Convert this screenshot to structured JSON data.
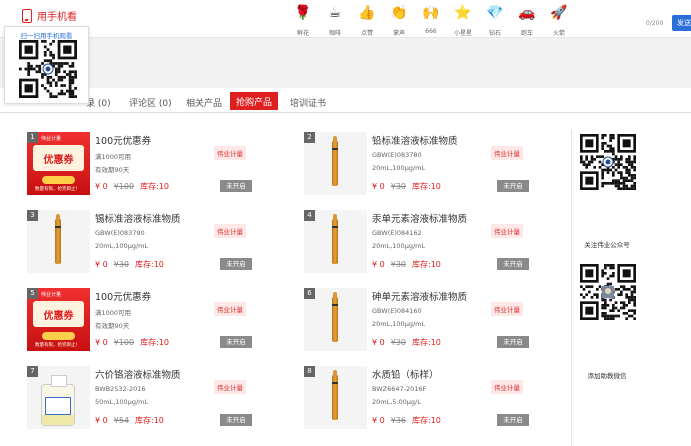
{
  "header": {
    "phone_view_label": "用手机看",
    "qr_popup_title": "扫一扫用手机观看",
    "gifts": [
      {
        "icon": "rose-icon",
        "glyph": "🌹",
        "label": "鲜花"
      },
      {
        "icon": "coffee-icon",
        "glyph": "☕",
        "label": "咖啡"
      },
      {
        "icon": "like-icon",
        "glyph": "👍",
        "label": "点赞"
      },
      {
        "icon": "applause-icon",
        "glyph": "👏",
        "label": "掌声"
      },
      {
        "icon": "666-icon",
        "glyph": "🙌",
        "label": "666"
      },
      {
        "icon": "little-star-icon",
        "glyph": "⭐",
        "label": "小星星"
      },
      {
        "icon": "diamond-icon",
        "glyph": "💎",
        "label": "钻石"
      },
      {
        "icon": "sports-car-icon",
        "glyph": "🚗",
        "label": "跑车"
      },
      {
        "icon": "rocket-icon",
        "glyph": "🚀",
        "label": "火箭"
      }
    ],
    "char_count": "0/200",
    "send_label": "发送"
  },
  "tabs": [
    {
      "label": "录 (0)"
    },
    {
      "label": "评论区 (0)"
    },
    {
      "label": "相关产品"
    },
    {
      "label": "抢购产品",
      "active": true
    },
    {
      "label": "培训证书"
    }
  ],
  "products": [
    {
      "num": "1",
      "kind": "coupon",
      "title": "100元优惠券",
      "line1": "满1000可用",
      "line2": "有效期90天",
      "tag": "伟业计量",
      "price": "¥ 0",
      "old_price": "¥100",
      "stock": "库存:10",
      "status": "未开启",
      "coupon": {
        "top": "伟业计量",
        "text": "优惠券",
        "foot": "数量有限，抢完即止！"
      }
    },
    {
      "num": "2",
      "kind": "vial",
      "title": "铅标准溶液标准物质",
      "line1": "GBW(E)083780",
      "line2": "20mL,100μg/mL",
      "tag": "伟业计量",
      "price": "¥ 0",
      "old_price": "¥30",
      "stock": "库存:10",
      "status": "未开启"
    },
    {
      "num": "3",
      "kind": "vial",
      "title": "锡标准溶液标准物质",
      "line1": "GBW(E)083790",
      "line2": "20mL,100μg/mL",
      "tag": "伟业计量",
      "price": "¥ 0",
      "old_price": "¥30",
      "stock": "库存:10",
      "status": "未开启"
    },
    {
      "num": "4",
      "kind": "vial",
      "title": "汞单元素溶液标准物质",
      "line1": "GBW(E)084162",
      "line2": "20mL,100μg/mL",
      "tag": "伟业计量",
      "price": "¥ 0",
      "old_price": "¥30",
      "stock": "库存:10",
      "status": "未开启"
    },
    {
      "num": "5",
      "kind": "coupon",
      "title": "100元优惠券",
      "line1": "满1000可用",
      "line2": "有效期90天",
      "tag": "伟业计量",
      "price": "¥ 0",
      "old_price": "¥100",
      "stock": "库存:10",
      "status": "未开启",
      "coupon": {
        "top": "伟业计量",
        "text": "优惠券",
        "foot": "数量有限，抢完即止！"
      }
    },
    {
      "num": "6",
      "kind": "vial",
      "title": "砷单元素溶液标准物质",
      "line1": "GBW(E)084160",
      "line2": "20mL,100μg/mL",
      "tag": "伟业计量",
      "price": "¥ 0",
      "old_price": "¥30",
      "stock": "库存:10",
      "status": "未开启"
    },
    {
      "num": "7",
      "kind": "bottle",
      "title": "六价铬溶液标准物质",
      "line1": "BWB2532-2016",
      "line2": "50mL,100μg/mL",
      "tag": "伟业计量",
      "price": "¥ 0",
      "old_price": "¥54",
      "stock": "库存:10",
      "status": "未开启"
    },
    {
      "num": "8",
      "kind": "vial",
      "title": "水质铅（标样）",
      "line1": "BWZ6647-2016F",
      "line2": "20mL,5.00μg/L",
      "tag": "伟业计量",
      "price": "¥ 0",
      "old_price": "¥36",
      "stock": "库存:10",
      "status": "未开启"
    }
  ],
  "sidebar": {
    "follow_label": "关注伟业公众号",
    "add_assistant_label": "添加助教微信"
  },
  "colors": {
    "accent_red": "#e02020",
    "send_blue": "#2a6ed8"
  }
}
